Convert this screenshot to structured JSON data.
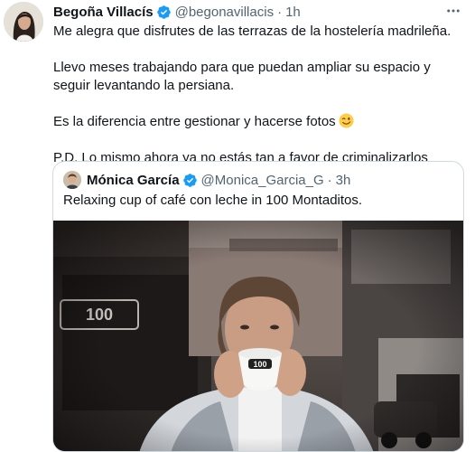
{
  "tweet": {
    "author": {
      "name": "Begoña Villacís",
      "handle": "@begonavillacis",
      "separator": "·",
      "time": "1h"
    },
    "more_icon": "more-options-icon",
    "body": {
      "p1": "Me alegra que disfrutes de las terrazas de la hostelería madrileña.",
      "p2": "Llevo meses trabajando para que puedan ampliar su espacio y seguir levantando la persiana.",
      "p3": "Es la diferencia entre gestionar y hacerse fotos",
      "p3_emoji": "winking-face-emoji",
      "p4": "P.D. Lo mismo ahora ya no estás tan a favor de criminalizarlos"
    }
  },
  "quoted_tweet": {
    "author": {
      "name": "Mónica García",
      "handle": "@Monica_Garcia_G",
      "separator": "·",
      "time": "3h"
    },
    "text": "Relaxing cup of café con leche in 100 Montaditos.",
    "photo": {
      "cup_logo": "100",
      "sign_text": "100"
    }
  },
  "colors": {
    "text_primary": "#0f1419",
    "text_secondary": "#536471",
    "verified_blue": "#1d9bf0",
    "border": "#cfd9de"
  }
}
